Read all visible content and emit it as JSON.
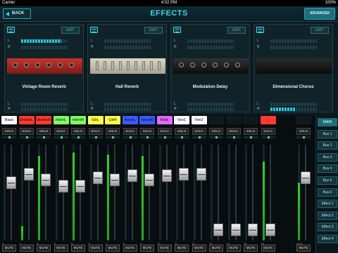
{
  "status": {
    "carrier": "Carrier",
    "time": "4:02 PM",
    "battery": "100%"
  },
  "header": {
    "back_label": "BACK",
    "title": "EFFECTS",
    "advanced_label": "ADVANCED"
  },
  "effects": [
    {
      "name": "Vintage Room Reverb",
      "edit_label": "EDIT",
      "l": 0.86,
      "r": 0.0,
      "out_l": 0.0,
      "out_r": 0.0
    },
    {
      "name": "Hall Reverb",
      "edit_label": "EDIT",
      "l": 0.0,
      "r": 0.0,
      "out_l": 0.0,
      "out_r": 0.0
    },
    {
      "name": "Modulation Delay",
      "edit_label": "EDIT",
      "l": 0.0,
      "r": 0.0,
      "out_l": 0.0,
      "out_r": 0.0
    },
    {
      "name": "Dimensional Chorus",
      "edit_label": "EDIT",
      "l": 0.0,
      "r": 0.0,
      "out_l": 0.0,
      "out_r": 0.55
    }
  ],
  "meter_labels": {
    "l": "L",
    "r": "R"
  },
  "channels": [
    {
      "name": "Bass",
      "color": "#ffffff",
      "solo": "SOLO",
      "mute": "MUTE",
      "level": 0.0,
      "fader": 0.62,
      "num": "1"
    },
    {
      "name": "DrumsL",
      "color": "#ff3b2f",
      "solo": "SOLO",
      "mute": "MUTE",
      "level": 0.15,
      "fader": 0.72,
      "num": "2"
    },
    {
      "name": "DrumsR",
      "color": "#ff3b2f",
      "solo": "SOLO",
      "mute": "MUTE",
      "level": 0.88,
      "fader": 0.65,
      "num": "3"
    },
    {
      "name": "HornL",
      "color": "#7dff63",
      "solo": "SOLO",
      "mute": "MUTE",
      "level": 0.0,
      "fader": 0.58,
      "num": "4"
    },
    {
      "name": "HornR",
      "color": "#7dff63",
      "solo": "SOLO",
      "mute": "MUTE",
      "level": 0.92,
      "fader": 0.58,
      "num": "5"
    },
    {
      "name": "GtrL",
      "color": "#ffff4d",
      "solo": "SOLO",
      "mute": "MUTE",
      "level": 0.0,
      "fader": 0.68,
      "num": "6"
    },
    {
      "name": "GtrR",
      "color": "#ffff4d",
      "solo": "SOLO",
      "mute": "MUTE",
      "level": 0.9,
      "fader": 0.65,
      "num": "7"
    },
    {
      "name": "KeysL",
      "color": "#3a5bff",
      "solo": "SOLO",
      "mute": "MUTE",
      "level": 0.0,
      "fader": 0.7,
      "num": "8"
    },
    {
      "name": "KeysR",
      "color": "#3a5bff",
      "solo": "SOLO",
      "mute": "MUTE",
      "level": 0.88,
      "fader": 0.65,
      "num": "9"
    },
    {
      "name": "Klick",
      "color": "#e06bff",
      "solo": "SOLO",
      "mute": "MUTE",
      "level": 0.0,
      "fader": 0.7,
      "num": "10"
    },
    {
      "name": "Vox1",
      "color": "#ffffff",
      "solo": "SOLO",
      "mute": "MUTE",
      "level": 0.0,
      "fader": 0.72,
      "num": "11"
    },
    {
      "name": "Vox2",
      "color": "#ffffff",
      "solo": "SOLO",
      "mute": "MUTE",
      "level": 0.0,
      "fader": 0.72,
      "num": "12"
    },
    {
      "name": "",
      "color": "#101a1d",
      "solo": "SOLO",
      "mute": "MUTE",
      "level": 0.0,
      "fader": 0.05,
      "num": "13"
    },
    {
      "name": "",
      "color": "#101a1d",
      "solo": "SOLO",
      "mute": "MUTE",
      "level": 0.0,
      "fader": 0.05,
      "num": "14"
    },
    {
      "name": "",
      "color": "#101a1d",
      "solo": "SOLO",
      "mute": "MUTE",
      "level": 0.0,
      "fader": 0.05,
      "num": "15"
    },
    {
      "name": "",
      "color": "#ff3b2f",
      "solo": "SOLO",
      "mute": "MUTE",
      "level": 0.82,
      "fader": 0.05,
      "num": "16"
    },
    {
      "name": "",
      "color": "#101a1d",
      "solo": "SOLO",
      "mute": "MUTE",
      "level": 0.6,
      "fader": 0.68,
      "num": "AUX"
    }
  ],
  "buses": [
    "MAIN",
    "Bus 1",
    "Bus 2",
    "Bus 3",
    "Bus 4",
    "Bus 5",
    "Bus 6",
    "Effect 1",
    "Effect 2",
    "Effect 3",
    "Effect 4"
  ],
  "active_bus": "MAIN"
}
